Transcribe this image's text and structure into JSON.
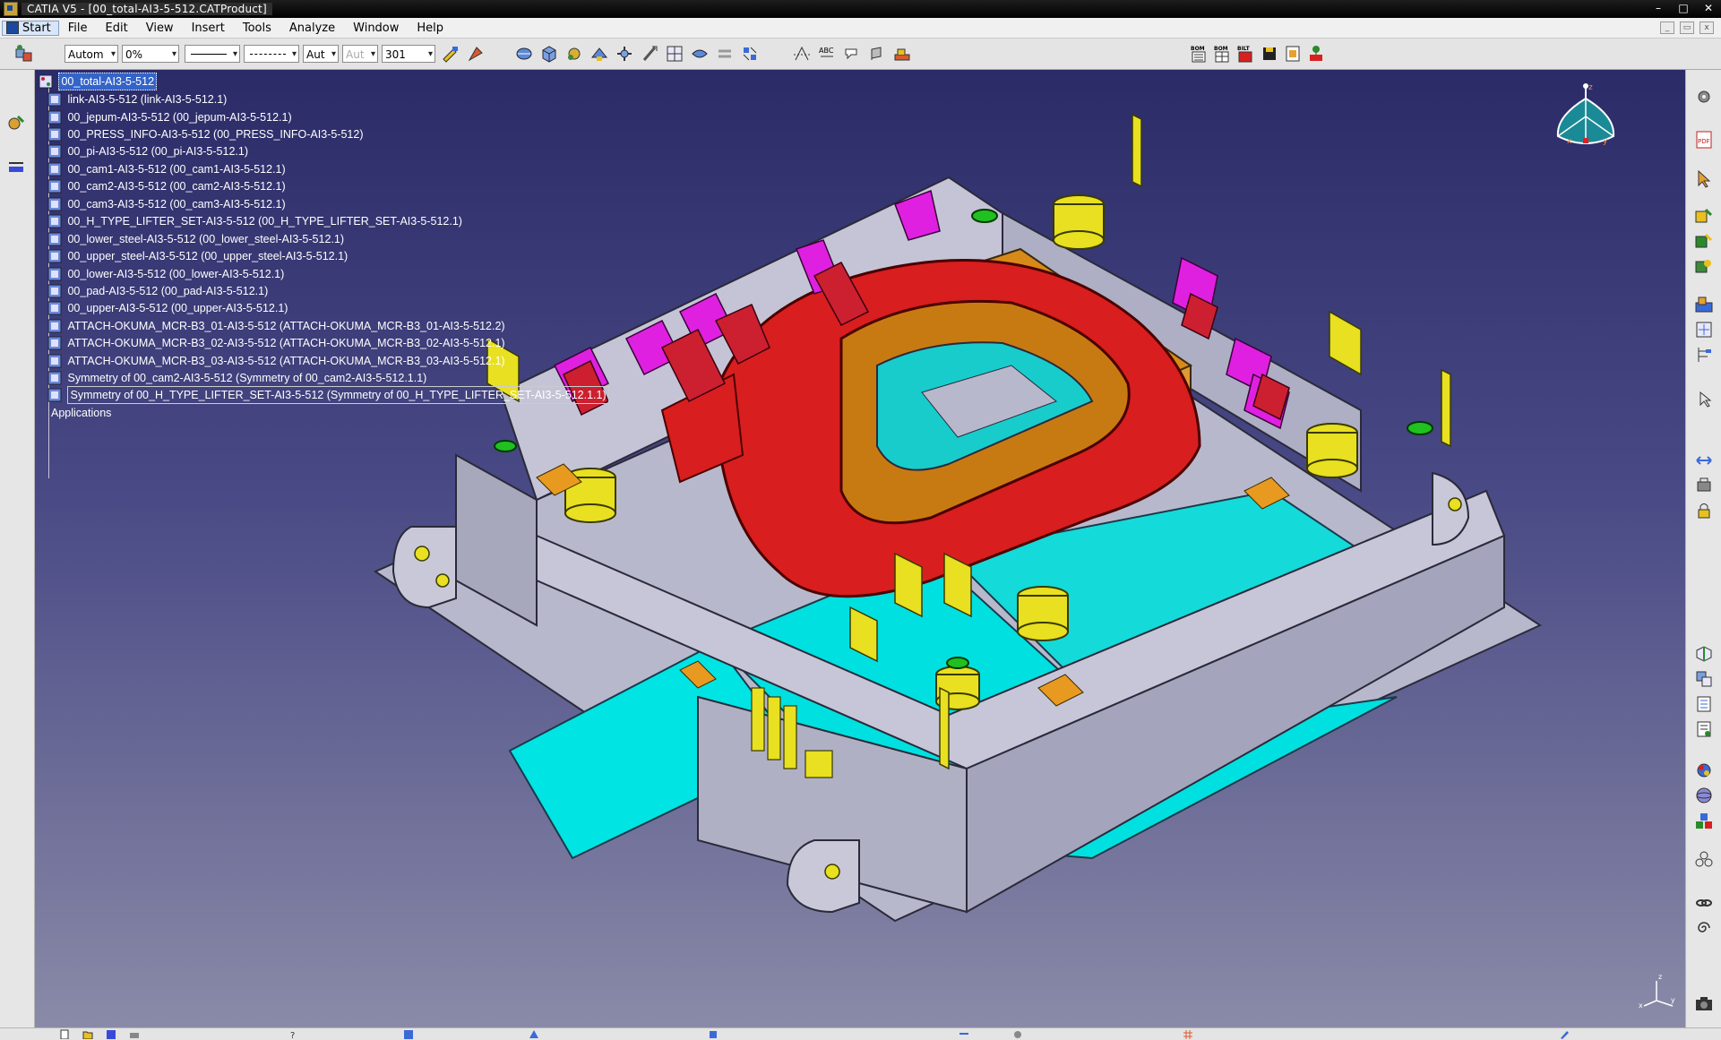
{
  "window": {
    "title": "CATIA V5 - [00_total-AI3-5-512.CATProduct]",
    "controls": [
      "–",
      "□",
      "✕"
    ]
  },
  "menu": {
    "items": [
      "Start",
      "File",
      "Edit",
      "View",
      "Insert",
      "Tools",
      "Analyze",
      "Window",
      "Help"
    ]
  },
  "toolbar": {
    "color_select": "Autom",
    "transparency_select": "0%",
    "layer_select": "Aut",
    "rendering_select": "Aut",
    "weight_select": "301",
    "bom_labels": [
      "BOM",
      "BOM",
      "BILT"
    ]
  },
  "tree": {
    "root": "00_total-AI3-5-512",
    "items": [
      "link-AI3-5-512 (link-AI3-5-512.1)",
      "00_jepum-AI3-5-512 (00_jepum-AI3-5-512.1)",
      "00_PRESS_INFO-AI3-5-512 (00_PRESS_INFO-AI3-5-512)",
      "00_pi-AI3-5-512 (00_pi-AI3-5-512.1)",
      "00_cam1-AI3-5-512 (00_cam1-AI3-5-512.1)",
      "00_cam2-AI3-5-512 (00_cam2-AI3-5-512.1)",
      "00_cam3-AI3-5-512 (00_cam3-AI3-5-512.1)",
      "00_H_TYPE_LIFTER_SET-AI3-5-512 (00_H_TYPE_LIFTER_SET-AI3-5-512.1)",
      "00_lower_steel-AI3-5-512 (00_lower_steel-AI3-5-512.1)",
      "00_upper_steel-AI3-5-512 (00_upper_steel-AI3-5-512.1)",
      "00_lower-AI3-5-512 (00_lower-AI3-5-512.1)",
      "00_pad-AI3-5-512 (00_pad-AI3-5-512.1)",
      "00_upper-AI3-5-512 (00_upper-AI3-5-512.1)",
      "ATTACH-OKUMA_MCR-B3_01-AI3-5-512 (ATTACH-OKUMA_MCR-B3_01-AI3-5-512.2)",
      "ATTACH-OKUMA_MCR-B3_02-AI3-5-512 (ATTACH-OKUMA_MCR-B3_02-AI3-5-512.1)",
      "ATTACH-OKUMA_MCR-B3_03-AI3-5-512 (ATTACH-OKUMA_MCR-B3_03-AI3-5-512.1)",
      "Symmetry of 00_cam2-AI3-5-512 (Symmetry of 00_cam2-AI3-5-512.1.1)",
      "Symmetry of 00_H_TYPE_LIFTER_SET-AI3-5-512 (Symmetry of 00_H_TYPE_LIFTER_SET-AI3-5-512.1.1)"
    ],
    "applications": "Applications"
  },
  "compass": {
    "x_label": "x",
    "y_label": "y",
    "z_label": "z"
  },
  "axis_triad": {
    "z_label": "z",
    "x_label": "x",
    "y_label": "y"
  },
  "colors": {
    "background_top": "#2b2b68",
    "background_bottom": "#8a8aa8",
    "part_red": "#d81e1e",
    "part_cyan": "#00e8e8",
    "part_grey": "#b8b8cc",
    "part_yellow": "#e8e020",
    "part_magenta": "#e020e0",
    "part_orange": "#e89a20",
    "selection": "#3464c8"
  }
}
